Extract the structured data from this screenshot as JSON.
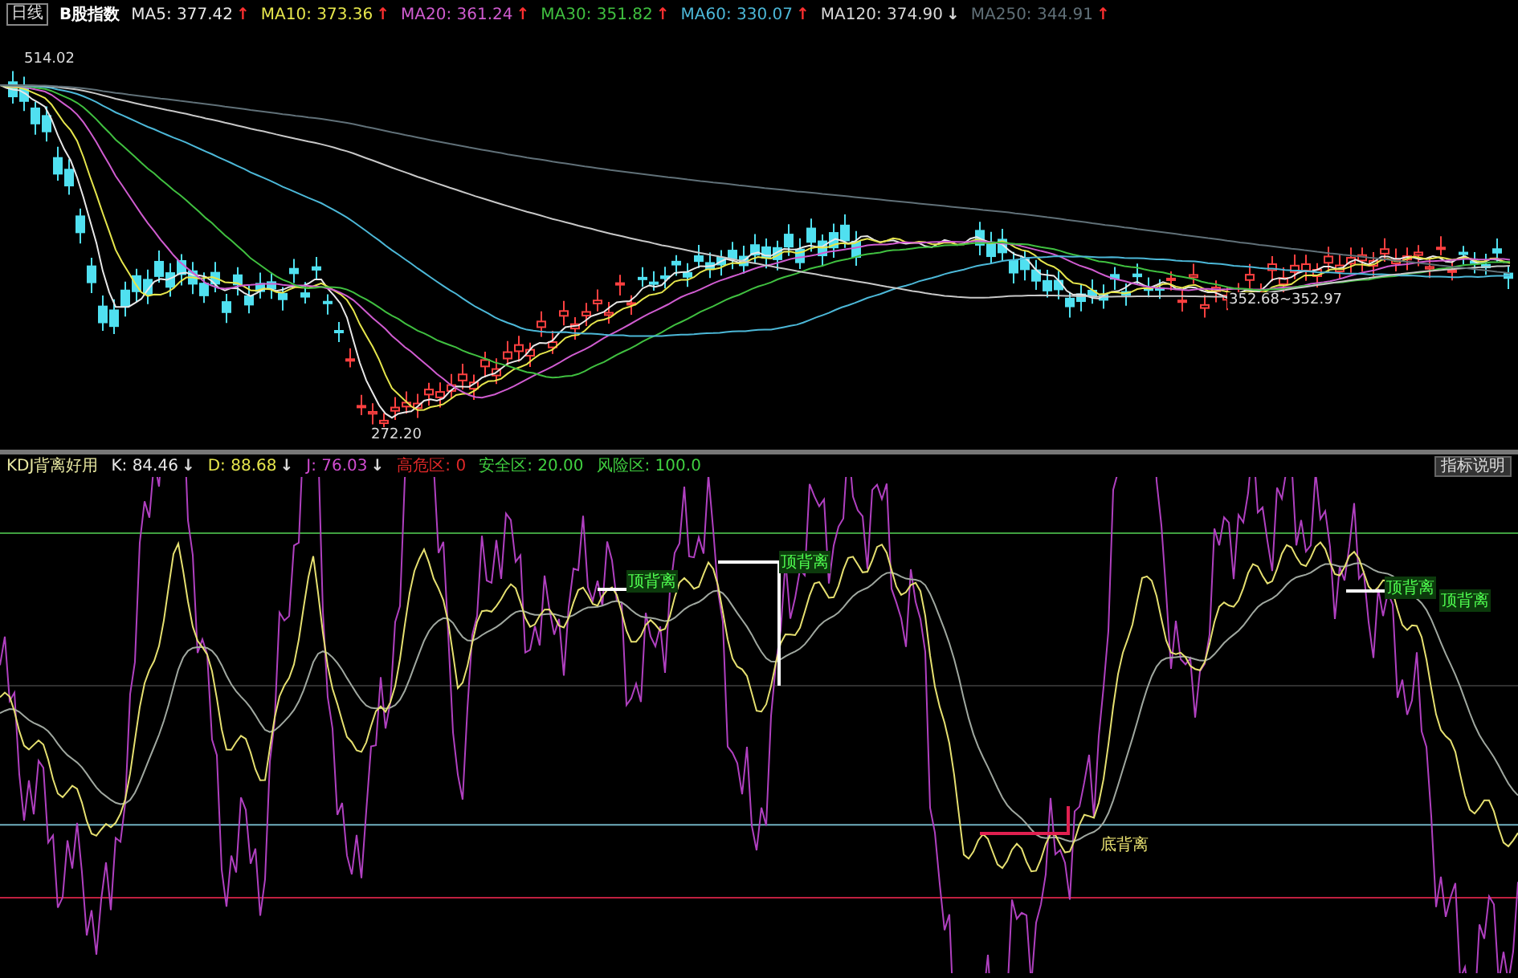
{
  "chart": {
    "period": "日线",
    "index_name": "B股指数",
    "ma_lines": [
      {
        "label": "MA5: 377.42",
        "arrow": "↑",
        "rising": true,
        "color": "#e8e8e8"
      },
      {
        "label": "MA10: 373.36",
        "arrow": "↑",
        "rising": true,
        "color": "#e6e64c"
      },
      {
        "label": "MA20: 361.24",
        "arrow": "↑",
        "rising": true,
        "color": "#d05cd0"
      },
      {
        "label": "MA30: 351.82",
        "arrow": "↑",
        "rising": true,
        "color": "#40c040"
      },
      {
        "label": "MA60: 330.07",
        "arrow": "↑",
        "rising": true,
        "color": "#4cb8d8"
      },
      {
        "label": "MA120: 374.90",
        "arrow": "↓",
        "rising": false,
        "color": "#d8d8d8"
      },
      {
        "label": "MA250: 344.91",
        "arrow": "↑",
        "rising": true,
        "color": "#607078"
      }
    ],
    "price_labels": [
      "514.02",
      "272.20",
      "352.68~352.97"
    ]
  },
  "indicator": {
    "name": "KDJ背离好用",
    "values": [
      {
        "label": "K: 84.46",
        "arrow": "↓",
        "rising": false,
        "color": "#e8e8e8"
      },
      {
        "label": "D: 88.68",
        "arrow": "↓",
        "rising": false,
        "color": "#e6e64c"
      },
      {
        "label": "J: 76.03",
        "arrow": "↓",
        "rising": false,
        "color": "#d04cd0"
      },
      {
        "label": "高危区: 0",
        "color": "#e02828"
      },
      {
        "label": "安全区: 20.00",
        "color": "#40d040"
      },
      {
        "label": "风险区: 100.0",
        "color": "#40d040"
      }
    ],
    "help_button": "指标说明",
    "annotations": [
      {
        "text": "顶背离",
        "kind": "top"
      },
      {
        "text": "顶背离",
        "kind": "top"
      },
      {
        "text": "底背离",
        "kind": "bottom"
      },
      {
        "text": "顶背离",
        "kind": "top"
      },
      {
        "text": "顶背离",
        "kind": "top"
      }
    ]
  }
}
